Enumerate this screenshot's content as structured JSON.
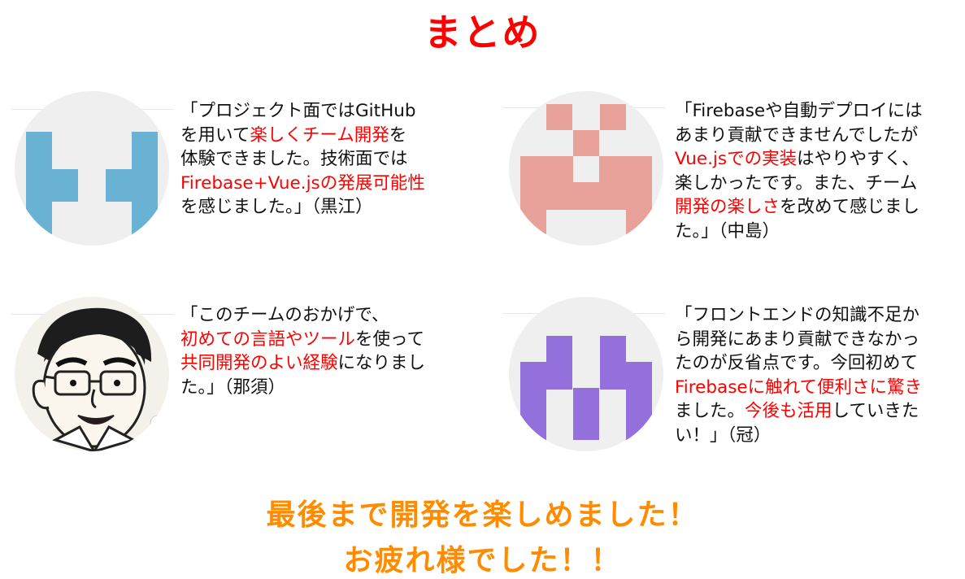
{
  "title": "まとめ",
  "accent_color": "#ff0000",
  "closing_color": "#ff8c00",
  "testimonials": [
    {
      "author": "黒江",
      "avatar_color": "#6ab2d3",
      "lines": [
        [
          {
            "t": "「プロジェクト面ではGitHub",
            "h": false
          }
        ],
        [
          {
            "t": "を用いて",
            "h": false
          },
          {
            "t": "楽しくチーム開発",
            "h": true
          },
          {
            "t": "を",
            "h": false
          }
        ],
        [
          {
            "t": "体験できました。技術面では",
            "h": false
          }
        ],
        [
          {
            "t": "Firebase+Vue.jsの発展可能性",
            "h": true
          }
        ],
        [
          {
            "t": "を感じました。」（黒江）",
            "h": false
          }
        ]
      ]
    },
    {
      "author": "中島",
      "avatar_color": "#e8a199",
      "lines": [
        [
          {
            "t": "「Firebaseや自動デプロイには",
            "h": false
          }
        ],
        [
          {
            "t": "あまり貢献できませんでしたが",
            "h": false
          }
        ],
        [
          {
            "t": "Vue.jsでの実装",
            "h": true
          },
          {
            "t": "はやりやすく、",
            "h": false
          }
        ],
        [
          {
            "t": "楽しかったです。また、チーム",
            "h": false
          }
        ],
        [
          {
            "t": "開発の楽しさ",
            "h": true
          },
          {
            "t": "を改めて感じまし",
            "h": false
          }
        ],
        [
          {
            "t": "た。」（中島）",
            "h": false
          }
        ]
      ]
    },
    {
      "author": "那須",
      "avatar_color": "#222222",
      "lines": [
        [
          {
            "t": "「このチームのおかげで、",
            "h": false
          }
        ],
        [
          {
            "t": "初めての言語やツール",
            "h": true
          },
          {
            "t": "を使って",
            "h": false
          }
        ],
        [
          {
            "t": "共同開発のよい経験",
            "h": true
          },
          {
            "t": "になりまし",
            "h": false
          }
        ],
        [
          {
            "t": "た。」（那須）",
            "h": false
          }
        ]
      ]
    },
    {
      "author": "冠",
      "avatar_color": "#9370db",
      "lines": [
        [
          {
            "t": "「フロントエンドの知識不足か",
            "h": false
          }
        ],
        [
          {
            "t": "ら開発にあまり貢献できなかっ",
            "h": false
          }
        ],
        [
          {
            "t": "たのが反省点です。今回初めて",
            "h": false
          }
        ],
        [
          {
            "t": "Firebaseに触れて便利さに驚き",
            "h": true
          }
        ],
        [
          {
            "t": "ました。",
            "h": false
          },
          {
            "t": "今後も活用",
            "h": true
          },
          {
            "t": "していきた",
            "h": false
          }
        ],
        [
          {
            "t": "い！」（冠）",
            "h": false
          }
        ]
      ]
    }
  ],
  "closing": {
    "line1": "最後まで開発を楽しめました！",
    "line2": "お疲れ様でした！！"
  }
}
